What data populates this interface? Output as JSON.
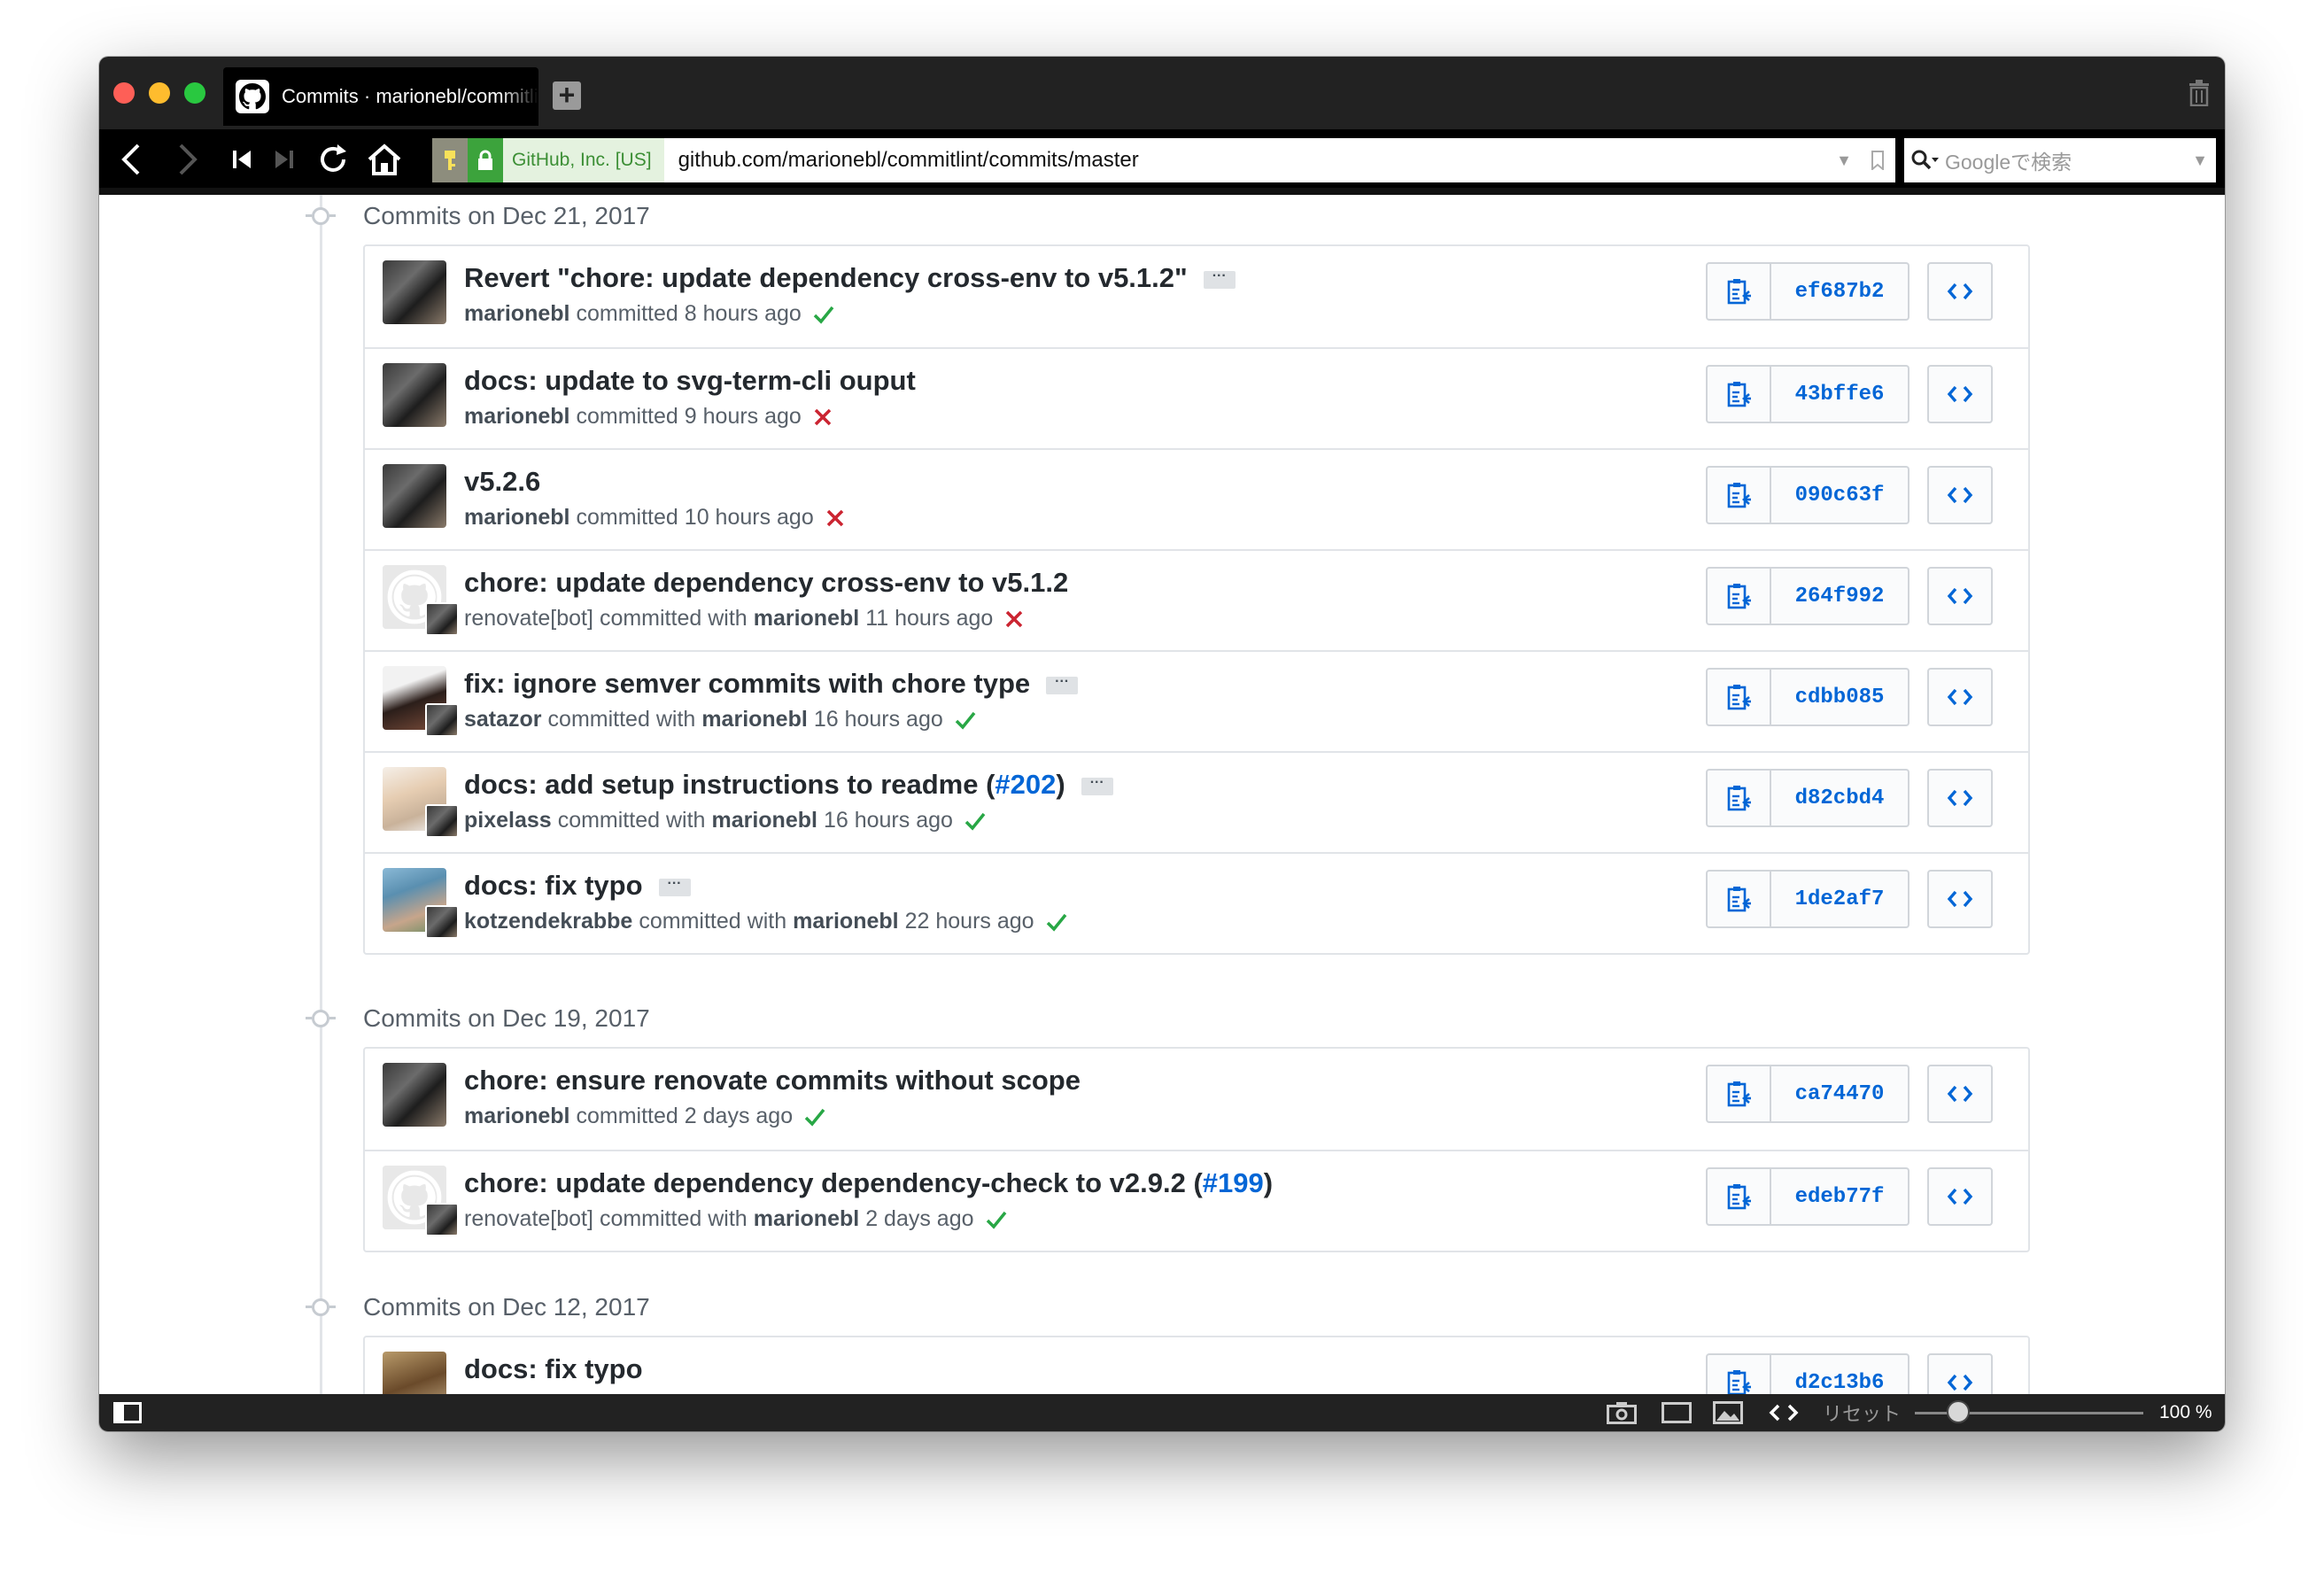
{
  "browser": {
    "tab_title": "Commits · marionebl/commitlint",
    "new_tab_label": "+",
    "cert_label": "GitHub, Inc. [US]",
    "url": "github.com/marionebl/commitlint/commits/master",
    "search_placeholder": "Googleで検索"
  },
  "statusbar": {
    "reset_label": "リセット",
    "zoom_label": "100 %",
    "zoom_level_percent": 100
  },
  "colors": {
    "success": "#28a745",
    "failure": "#cb2431",
    "link": "#0366d6"
  },
  "groups": [
    {
      "title": "Commits on Dec 21, 2017",
      "commits": [
        {
          "avatar": "mb",
          "coauthor": false,
          "message": "Revert \"chore: update dependency cross-env to v5.1.2\"",
          "link": "",
          "close": "",
          "has_more": true,
          "author": "marionebl",
          "verb": "committed",
          "with_label": "",
          "committer": "",
          "time": "8 hours ago",
          "status": "success",
          "sha": "ef687b2"
        },
        {
          "avatar": "mb",
          "coauthor": false,
          "message": "docs: update to svg-term-cli ouput",
          "link": "",
          "close": "",
          "has_more": false,
          "author": "marionebl",
          "verb": "committed",
          "with_label": "",
          "committer": "",
          "time": "9 hours ago",
          "status": "failure",
          "sha": "43bffe6"
        },
        {
          "avatar": "mb",
          "coauthor": false,
          "message": "v5.2.6",
          "link": "",
          "close": "",
          "has_more": false,
          "author": "marionebl",
          "verb": "committed",
          "with_label": "",
          "committer": "",
          "time": "10 hours ago",
          "status": "failure",
          "sha": "090c63f"
        },
        {
          "avatar": "gh",
          "coauthor": true,
          "message": "chore: update dependency cross-env to v5.1.2",
          "link": "",
          "close": "",
          "has_more": false,
          "author": "renovate[bot]",
          "author_plain": true,
          "verb": "committed",
          "with_label": "with",
          "committer": "marionebl",
          "time": "11 hours ago",
          "status": "failure",
          "sha": "264f992"
        },
        {
          "avatar": "sat",
          "coauthor": true,
          "message": "fix: ignore semver commits with chore type",
          "link": "",
          "close": "",
          "has_more": true,
          "author": "satazor",
          "verb": "committed",
          "with_label": "with",
          "committer": "marionebl",
          "time": "16 hours ago",
          "status": "success",
          "sha": "cdbb085"
        },
        {
          "avatar": "pix",
          "coauthor": true,
          "message": "docs: add setup instructions to readme (",
          "link": "#202",
          "close": ")",
          "has_more": true,
          "author": "pixelass",
          "verb": "committed",
          "with_label": "with",
          "committer": "marionebl",
          "time": "16 hours ago",
          "status": "success",
          "sha": "d82cbd4"
        },
        {
          "avatar": "kot",
          "coauthor": true,
          "message": "docs: fix typo",
          "link": "",
          "close": "",
          "has_more": true,
          "author": "kotzendekrabbe",
          "verb": "committed",
          "with_label": "with",
          "committer": "marionebl",
          "time": "22 hours ago",
          "status": "success",
          "sha": "1de2af7"
        }
      ]
    },
    {
      "title": "Commits on Dec 19, 2017",
      "commits": [
        {
          "avatar": "mb",
          "coauthor": false,
          "message": "chore: ensure renovate commits without scope",
          "link": "",
          "close": "",
          "has_more": false,
          "author": "marionebl",
          "verb": "committed",
          "with_label": "",
          "committer": "",
          "time": "2 days ago",
          "status": "success",
          "sha": "ca74470"
        },
        {
          "avatar": "gh",
          "coauthor": true,
          "message": "chore: update dependency dependency-check to v2.9.2 (",
          "link": "#199",
          "close": ")",
          "has_more": false,
          "author": "renovate[bot]",
          "author_plain": true,
          "verb": "committed",
          "with_label": "with",
          "committer": "marionebl",
          "time": "2 days ago",
          "status": "success",
          "sha": "edeb77f"
        }
      ]
    },
    {
      "title": "Commits on Dec 12, 2017",
      "commits": [
        {
          "avatar": "d",
          "coauthor": false,
          "message": "docs: fix typo",
          "link": "",
          "close": "",
          "has_more": false,
          "author": "",
          "verb": "",
          "with_label": "",
          "committer": "",
          "time": "",
          "status": "",
          "sha": "d2c13b6"
        }
      ]
    }
  ]
}
